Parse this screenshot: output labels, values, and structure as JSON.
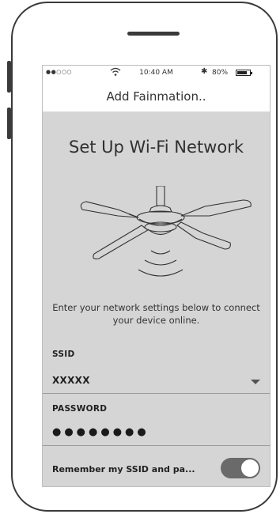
{
  "status_bar": {
    "signal": "●●○○○",
    "time": "10:40 AM",
    "battery_percent": "80%",
    "battery_level": 0.8
  },
  "nav": {
    "title": "Add Fainmation.."
  },
  "setup": {
    "title": "Set Up Wi-Fi Network",
    "instructions": "Enter your network settings below to connect your device online."
  },
  "form": {
    "ssid_label": "SSID",
    "ssid_value": "XXXXX",
    "password_label": "PASSWORD",
    "password_value": "●●●●●●●●",
    "remember_label": "Remember my SSID and pa...",
    "remember_on": true
  },
  "colors": {
    "screen_bg": "#d5d5d5",
    "toggle_on": "#6a6a6a"
  }
}
